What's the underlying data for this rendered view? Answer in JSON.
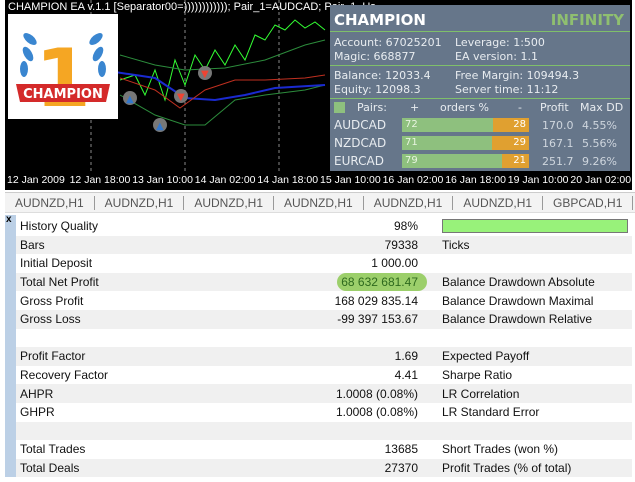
{
  "chart": {
    "title": "CHAMPION EA v.1.1 [Separator00=)))))))))))); Pair_1=AUDCAD; Pair_1_Us",
    "time_axis": [
      "12 Jan 2009",
      "12 Jan 18:00",
      "13 Jan 10:00",
      "14 Jan 02:00",
      "14 Jan 18:00",
      "15 Jan 10:00",
      "16 Jan 02:00",
      "16 Jan 18:00",
      "19 Jan 10:00",
      "20 Jan 02:00"
    ]
  },
  "logo": {
    "text": "CHAMPION",
    "number": "1"
  },
  "panel": {
    "title": "CHAMPION",
    "subtitle": "INFINITY",
    "account": "Account: 67025201",
    "leverage": "Leverage:   1:500",
    "magic": "Magic:   668877",
    "ea_version": "EA version:  1.1",
    "balance": "Balance: 12033.4",
    "free_margin": "Free Margin: 109494.3",
    "equity": "Equity:   12098.3",
    "server_time": "Server time: 11:12",
    "headers": {
      "pairs": "Pairs:",
      "plus": "+",
      "orders": "orders %",
      "minus": "-",
      "profit": "Profit",
      "maxdd": "Max DD"
    },
    "pairs": [
      {
        "name": "AUDCAD",
        "plus": "72",
        "minus": "28",
        "plus_pct": 72,
        "profit": "170.0",
        "maxdd": "4.55%"
      },
      {
        "name": "NZDCAD",
        "plus": "71",
        "minus": "29",
        "plus_pct": 71,
        "profit": "167.1",
        "maxdd": "5.56%"
      },
      {
        "name": "EURCAD",
        "plus": "79",
        "minus": "21",
        "plus_pct": 79,
        "profit": "251.7",
        "maxdd": "9.26%"
      }
    ],
    "colors": {
      "bg": "#66768a",
      "green": "#8ec07e",
      "orange": "#e0a030",
      "accent": "#8fbf70"
    }
  },
  "tabs": [
    "AUDNZD,H1",
    "AUDNZD,H1",
    "AUDNZD,H1",
    "AUDNZD,H1",
    "AUDNZD,H1",
    "AUDNZD,H1",
    "GBPCAD,H1"
  ],
  "report": {
    "close": "x",
    "history_quality_pct": 98,
    "rows": [
      {
        "label": "History Quality",
        "value": "98%",
        "right": ""
      },
      {
        "label": "Bars",
        "value": "79338",
        "right": "Ticks"
      },
      {
        "label": "Initial Deposit",
        "value": "1 000.00",
        "right": ""
      },
      {
        "label": "Total Net Profit",
        "value": "68 632 681.47",
        "right": "Balance Drawdown Absolute"
      },
      {
        "label": "Gross Profit",
        "value": "168 029 835.14",
        "right": "Balance Drawdown Maximal"
      },
      {
        "label": "Gross Loss",
        "value": "-99 397 153.67",
        "right": "Balance Drawdown Relative"
      },
      {
        "label": "",
        "value": "",
        "right": ""
      },
      {
        "label": "Profit Factor",
        "value": "1.69",
        "right": "Expected Payoff"
      },
      {
        "label": "Recovery Factor",
        "value": "4.41",
        "right": "Sharpe Ratio"
      },
      {
        "label": "AHPR",
        "value": "1.0008 (0.08%)",
        "right": "LR Correlation"
      },
      {
        "label": "GHPR",
        "value": "1.0008 (0.08%)",
        "right": "LR Standard Error"
      },
      {
        "label": "",
        "value": "",
        "right": ""
      },
      {
        "label": "Total Trades",
        "value": "13685",
        "right": "Short Trades (won %)"
      },
      {
        "label": "Total Deals",
        "value": "27370",
        "right": "Profit Trades (% of total)"
      }
    ]
  }
}
